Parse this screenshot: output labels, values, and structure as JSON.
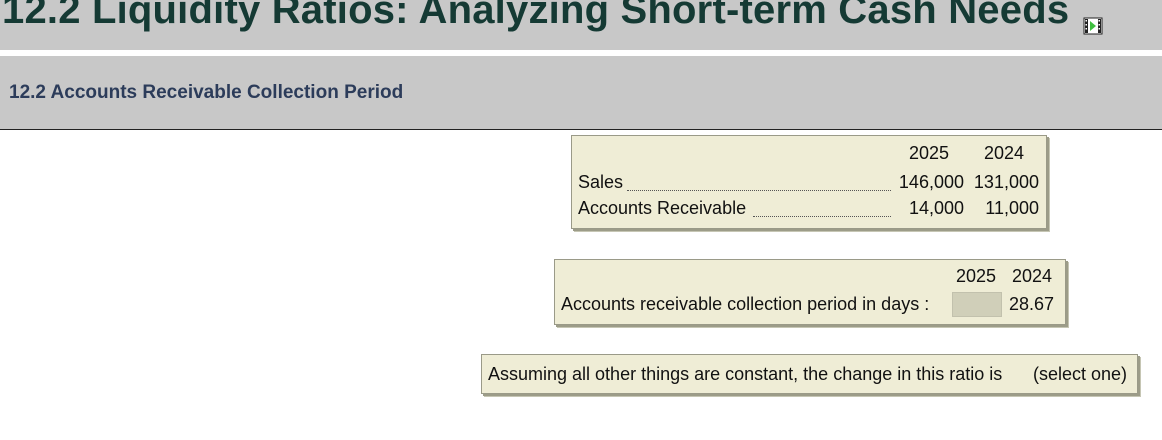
{
  "header": {
    "title": "12.2 Liquidity Ratios: Analyzing Short-term Cash Needs",
    "media_icon": "film-play-icon",
    "subtitle": "12.2 Accounts Receivable Collection Period"
  },
  "data_table": {
    "year_headers": [
      "2025",
      "2024"
    ],
    "rows": [
      {
        "label": "Sales",
        "v2025": "146,000",
        "v2024": "131,000"
      },
      {
        "label": "Accounts Receivable",
        "v2025": "14,000",
        "v2024": "11,000"
      }
    ]
  },
  "ratio_panel": {
    "year_headers": [
      "2025",
      "2024"
    ],
    "label": "Accounts receivable collection period in days :",
    "input_2025_value": "",
    "value_2024": "28.67"
  },
  "question_panel": {
    "prompt": "Assuming all other things are constant, the change in this ratio is",
    "select_label": "(select one)"
  }
}
